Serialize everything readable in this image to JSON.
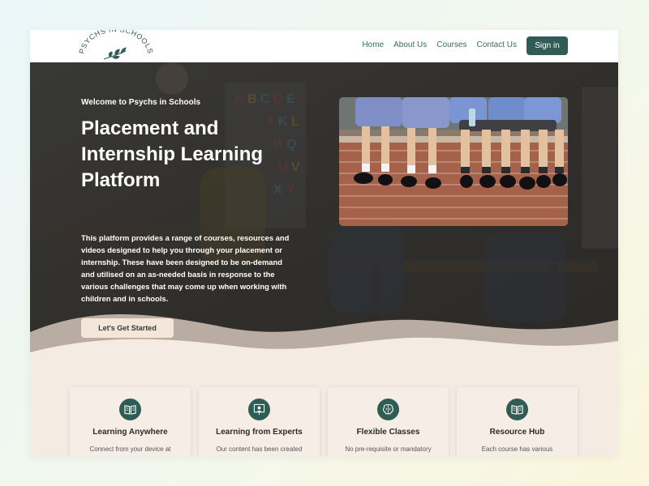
{
  "brand": {
    "name": "PSYCHS IN SCHOOLS"
  },
  "nav": {
    "links": [
      "Home",
      "About Us",
      "Courses",
      "Contact Us"
    ],
    "signin": "Sign in"
  },
  "hero": {
    "welcome": "Welcome to Psychs in Schools",
    "headline_lines": [
      "Placement and",
      "Internship Learning",
      "Platform"
    ],
    "description_lines": [
      "This platform provides a range of courses, resources and",
      "videos designed to help you through your placement or",
      "internship. These have been designed to be on-demand",
      "and utilised on an as-needed basis in response to the",
      "various challenges that may come up when working with",
      "children and in schools."
    ],
    "cta": "Let's Get Started"
  },
  "features": [
    {
      "icon": "book-icon",
      "title": "Learning Anywhere",
      "desc": "Connect from your device at"
    },
    {
      "icon": "teacher-icon",
      "title": "Learning from Experts",
      "desc": "Our content has been created"
    },
    {
      "icon": "brain-icon",
      "title": "Flexible Classes",
      "desc": "No pre-requisite or mandatory"
    },
    {
      "icon": "book-icon",
      "title": "Resource Hub",
      "desc": "Each course has various"
    }
  ],
  "colors": {
    "accent": "#2f5d55",
    "cream": "#f4ece3",
    "nav_text": "#3c6b62"
  }
}
